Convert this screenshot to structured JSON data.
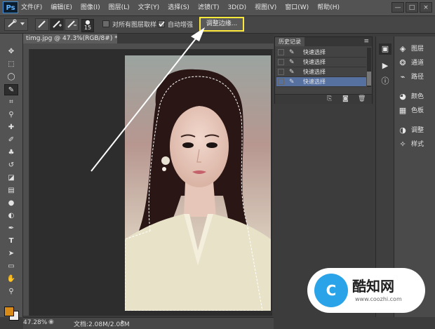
{
  "app": {
    "logo": "Ps"
  },
  "menubar": {
    "items": [
      "文件(F)",
      "编辑(E)",
      "图像(I)",
      "图层(L)",
      "文字(Y)",
      "选择(S)",
      "滤镜(T)",
      "3D(D)",
      "视图(V)",
      "窗口(W)",
      "帮助(H)"
    ],
    "window_controls": [
      "—",
      "□",
      "×"
    ]
  },
  "options_bar": {
    "brush_size": "15",
    "sample_all_layers": {
      "label": "对所有图层取样",
      "checked": false
    },
    "auto_enhance": {
      "label": "自动增强",
      "checked": true
    },
    "refine_edge_label": "调整边缘..."
  },
  "document": {
    "tab_title": "timg.jpg @ 47.3%(RGB/8#) *",
    "tab_close": "×"
  },
  "history_panel": {
    "tab_label": "历史记录",
    "items": [
      {
        "label": "快速选择",
        "selected": false
      },
      {
        "label": "快速选择",
        "selected": false
      },
      {
        "label": "快速选择",
        "selected": false
      },
      {
        "label": "快速选择",
        "selected": true
      }
    ]
  },
  "right_panel": {
    "items": [
      "图层",
      "通道",
      "路径",
      "颜色",
      "色板",
      "调整",
      "样式"
    ]
  },
  "status_bar": {
    "zoom": "47.28%",
    "doc_info": "文档:2.08M/2.08M"
  },
  "colors": {
    "foreground": "#d98b1a",
    "background": "#eeeeee",
    "highlight": "#ffe93b"
  },
  "watermark": {
    "logo_glyph": "C",
    "name": "酷知网",
    "url": "www.coozhi.com"
  }
}
